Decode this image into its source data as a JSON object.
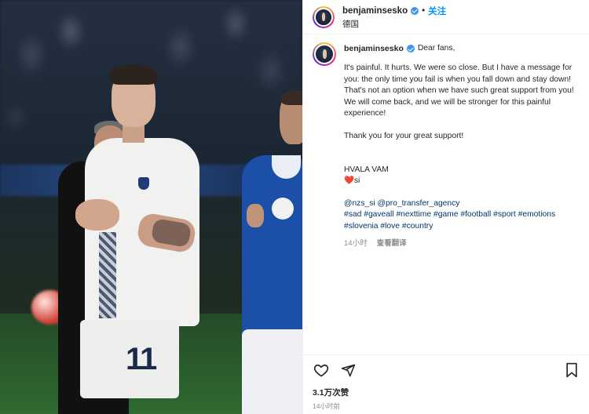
{
  "header": {
    "username": "benjaminsesko",
    "follow_label": "关注",
    "separator": "•",
    "location": "德国"
  },
  "caption": {
    "username": "benjaminsesko",
    "first_line": "Dear fans,",
    "paragraph1": "It's painful. It hurts. We were so close. But I have a message for you: the only time you fail is when you fall down and stay down! That's not an option when we have such great support from you! We will come back, and we will be stronger for this painful experience!",
    "paragraph2": "Thank you for your great support!",
    "hvala": "HVALA VAM",
    "heart": "❤️",
    "flag_text": "si",
    "mentions": [
      "@nzs_si",
      "@pro_transfer_agency"
    ],
    "hashtags": [
      "#sad",
      "#gaveall",
      "#nexttime",
      "#game",
      "#football",
      "#sport",
      "#emotions",
      "#slovenia",
      "#love",
      "#country"
    ],
    "time_ago": "14小时",
    "translate_label": "查看翻译"
  },
  "actions": {
    "icons": [
      "heart-icon",
      "share-icon",
      "bookmark-icon"
    ],
    "likes": "3.1万次赞",
    "timestamp": "14小时前"
  },
  "photo": {
    "jersey_number": "11"
  },
  "colors": {
    "link_blue": "#0095f6",
    "tag_blue": "#00376b",
    "verified_blue": "#3897f0",
    "muted": "#8e8e8e"
  }
}
